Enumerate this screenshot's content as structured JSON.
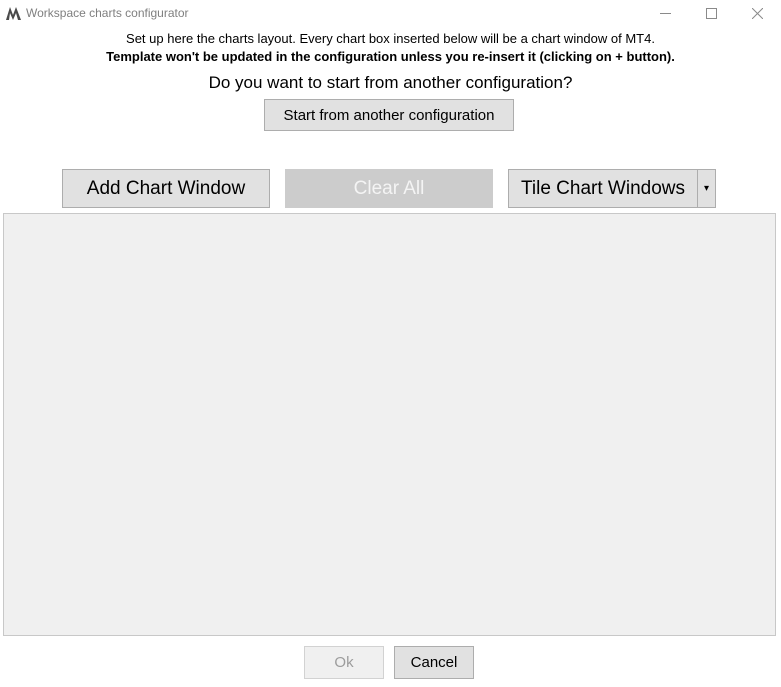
{
  "window": {
    "title": "Workspace charts configurator",
    "icon": "mt4-logo-icon",
    "controls": {
      "minimize": "—",
      "maximize": "☐",
      "close": "✕"
    }
  },
  "info": {
    "line1": "Set up here the charts layout. Every chart box inserted below will be a chart window of MT4.",
    "line2": "Template won't be updated in the configuration unless you re-insert it (clicking on + button).",
    "question": "Do you want to start from another configuration?"
  },
  "buttons": {
    "start_from_another": "Start from another configuration",
    "add_chart_window": "Add Chart Window",
    "clear_all": "Clear All",
    "tile_chart_windows": "Tile Chart Windows",
    "tile_dropdown": "▾",
    "ok": "Ok",
    "cancel": "Cancel"
  },
  "state": {
    "clear_all_enabled": false,
    "ok_enabled": false
  }
}
